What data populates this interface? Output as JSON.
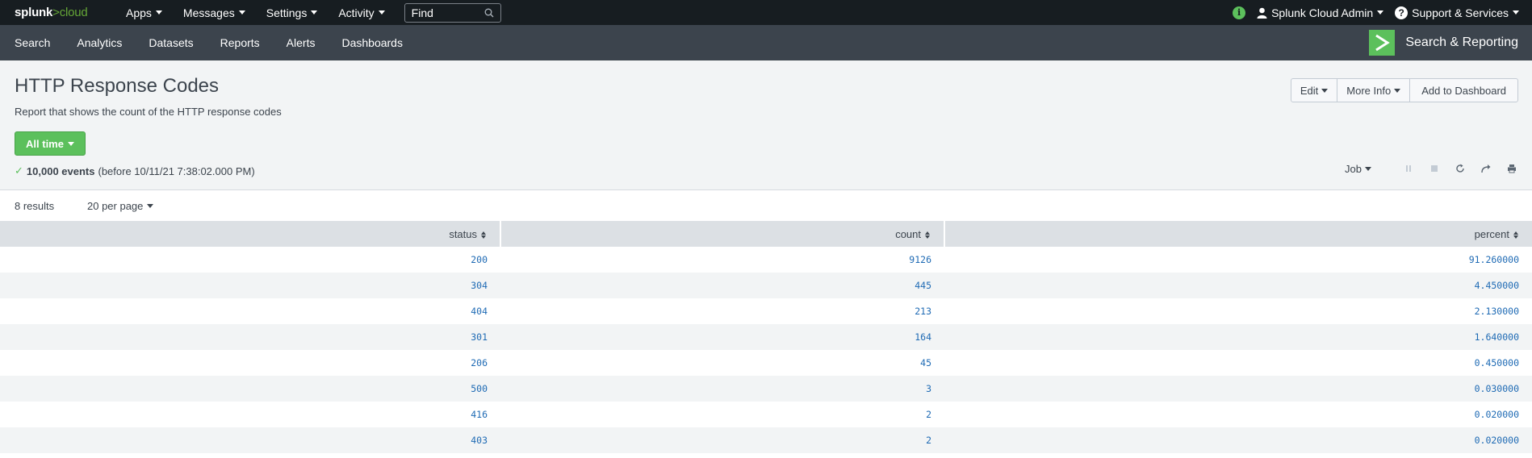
{
  "topbar": {
    "logo_main": "splunk",
    "logo_gt": ">",
    "logo_cloud": "cloud",
    "menu": [
      "Apps",
      "Messages",
      "Settings",
      "Activity"
    ],
    "find_placeholder": "Find",
    "user": "Splunk Cloud Admin",
    "support": "Support & Services",
    "info_icon": "info-icon"
  },
  "appbar": {
    "nav": [
      "Search",
      "Analytics",
      "Datasets",
      "Reports",
      "Alerts",
      "Dashboards"
    ],
    "app_name": "Search & Reporting",
    "logo_color": "#5cc05c"
  },
  "report": {
    "title": "HTTP Response Codes",
    "description": "Report that shows the count of the HTTP response codes",
    "buttons": {
      "edit": "Edit",
      "more_info": "More Info",
      "add": "Add to Dashboard"
    },
    "time_range": "All time",
    "events_count": "10,000 events",
    "events_detail": "(before 10/11/21 7:38:02.000 PM)",
    "job_label": "Job"
  },
  "results": {
    "count_label": "8 results",
    "per_page": "20 per page",
    "columns": [
      "status",
      "count",
      "percent"
    ],
    "rows": [
      [
        "200",
        "9126",
        "91.260000"
      ],
      [
        "304",
        "445",
        "4.450000"
      ],
      [
        "404",
        "213",
        "2.130000"
      ],
      [
        "301",
        "164",
        "1.640000"
      ],
      [
        "206",
        "45",
        "0.450000"
      ],
      [
        "500",
        "3",
        "0.030000"
      ],
      [
        "416",
        "2",
        "0.020000"
      ],
      [
        "403",
        "2",
        "0.020000"
      ]
    ]
  },
  "colors": {
    "topbar_bg": "#171d21",
    "appbar_bg": "#3c444d",
    "accent_green": "#5cc05c",
    "link_blue": "#1e6ab4"
  }
}
